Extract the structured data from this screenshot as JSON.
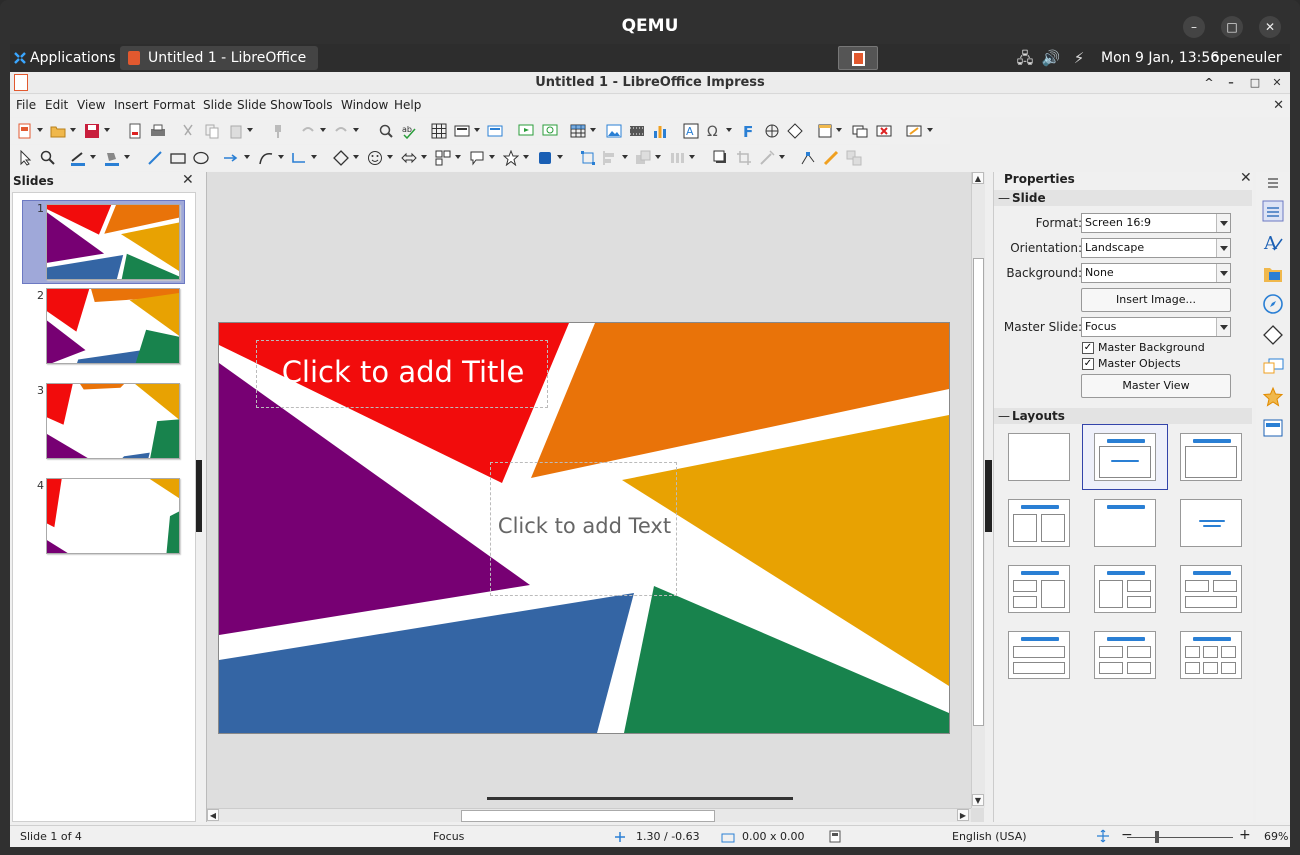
{
  "host": {
    "title": "QEMU",
    "controls": {
      "minimize": "–",
      "maximize": "□",
      "close": "✕"
    }
  },
  "panel": {
    "applications": "Applications",
    "task_label": "Untitled 1 - LibreOffice I...",
    "clock": "Mon  9 Jan, 13:56",
    "user": "openeuler"
  },
  "window": {
    "title": "Untitled 1 - LibreOffice Impress",
    "controls": {
      "minimize": "^",
      "maximize": "–",
      "restore": "□",
      "close": "✕"
    }
  },
  "menubar": {
    "items": [
      "File",
      "Edit",
      "View",
      "Insert",
      "Format",
      "Slide",
      "Slide Show",
      "Tools",
      "Window",
      "Help"
    ]
  },
  "slides_pane": {
    "title": "Slides",
    "close": "✕",
    "slides": [
      {
        "number": "1"
      },
      {
        "number": "2"
      },
      {
        "number": "3"
      },
      {
        "number": "4"
      }
    ]
  },
  "slide": {
    "title_placeholder": "Click to add Title",
    "text_placeholder": "Click to add Text"
  },
  "properties": {
    "title": "Properties",
    "close": "✕",
    "section_slide": "Slide",
    "format_label": "Format:",
    "format_value": "Screen 16:9",
    "orientation_label": "Orientation:",
    "orientation_value": "Landscape",
    "background_label": "Background:",
    "background_value": "None",
    "insert_image": "Insert Image...",
    "master_slide_label": "Master Slide:",
    "master_slide_value": "Focus",
    "master_background": "Master Background",
    "master_objects": "Master Objects",
    "master_view": "Master View",
    "section_layouts": "Layouts"
  },
  "status": {
    "slide": "Slide 1 of 4",
    "master": "Focus",
    "position": "1.30 / -0.63",
    "size": "0.00 x 0.00",
    "language": "English (USA)",
    "zoom_minus": "−",
    "zoom_plus": "+",
    "zoom": "69%"
  },
  "colors": {
    "red": "#f20c0c",
    "orange": "#e97309",
    "gold": "#e8a202",
    "purple": "#770073",
    "blue": "#3465a4",
    "green": "#18834d",
    "accent": "#2a7fd4"
  }
}
